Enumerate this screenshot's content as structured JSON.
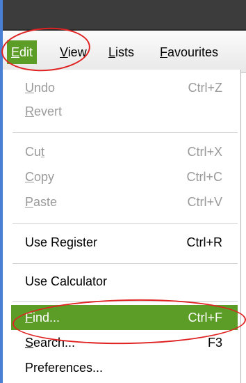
{
  "menubar": {
    "items": [
      {
        "label": "Edit",
        "underline_index": 0
      },
      {
        "label": "View",
        "underline_index": 0
      },
      {
        "label": "Lists",
        "underline_index": 0
      },
      {
        "label": "Favourites",
        "underline_index": 0
      }
    ]
  },
  "menu": {
    "items": [
      {
        "label": "Undo",
        "shortcut": "Ctrl+Z",
        "enabled": false
      },
      {
        "label": "Revert",
        "shortcut": "",
        "enabled": false
      },
      {
        "label": "Cut",
        "shortcut": "Ctrl+X",
        "enabled": false
      },
      {
        "label": "Copy",
        "shortcut": "Ctrl+C",
        "enabled": false
      },
      {
        "label": "Paste",
        "shortcut": "Ctrl+V",
        "enabled": false
      },
      {
        "label": "Use Register",
        "shortcut": "Ctrl+R",
        "enabled": true
      },
      {
        "label": "Use Calculator",
        "shortcut": "",
        "enabled": true
      },
      {
        "label": "Find...",
        "shortcut": "Ctrl+F",
        "enabled": true,
        "highlighted": true
      },
      {
        "label": "Search...",
        "shortcut": "F3",
        "enabled": true
      },
      {
        "label": "Preferences...",
        "shortcut": "",
        "enabled": true
      }
    ]
  },
  "colors": {
    "highlight": "#5c9d28",
    "annotation": "#e02222",
    "titlebar": "#3c3c3c"
  }
}
